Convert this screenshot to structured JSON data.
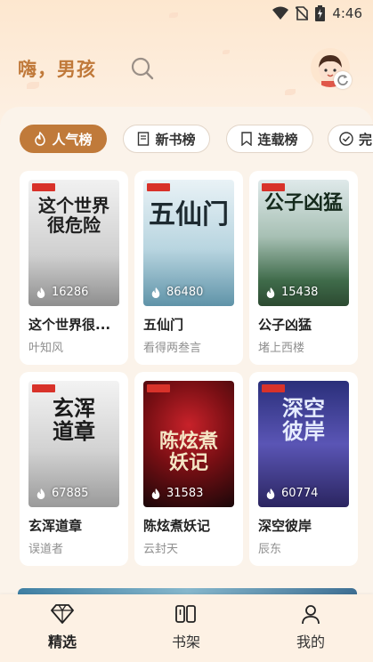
{
  "status_bar": {
    "time": "4:46"
  },
  "header": {
    "greeting": "嗨，男孩"
  },
  "tabs": [
    {
      "label": "人气榜",
      "active": true
    },
    {
      "label": "新书榜"
    },
    {
      "label": "连载榜"
    },
    {
      "label": "完"
    }
  ],
  "books": [
    {
      "title": "这个世界很...",
      "author": "叶知风",
      "heat": "16286",
      "cover_text": "这个世界很危险"
    },
    {
      "title": "五仙门",
      "author": "看得两叁言",
      "heat": "86480",
      "cover_text": "五仙门"
    },
    {
      "title": "公子凶猛",
      "author": "堵上西楼",
      "heat": "15438",
      "cover_text": "公子凶猛"
    },
    {
      "title": "玄浑道章",
      "author": "误道者",
      "heat": "67885",
      "cover_text": "玄浑道章"
    },
    {
      "title": "陈炫煮妖记",
      "author": "云封天",
      "heat": "31583",
      "cover_text": "陈炫煮妖记"
    },
    {
      "title": "深空彼岸",
      "author": "辰东",
      "heat": "60774",
      "cover_text": "深空彼岸"
    }
  ],
  "bottom_nav": [
    {
      "label": "精选",
      "icon": "diamond-icon",
      "active": true
    },
    {
      "label": "书架",
      "icon": "bookshelf-icon"
    },
    {
      "label": "我的",
      "icon": "profile-icon"
    }
  ],
  "colors": {
    "accent": "#c07a3a",
    "background": "#fbf3ea"
  }
}
